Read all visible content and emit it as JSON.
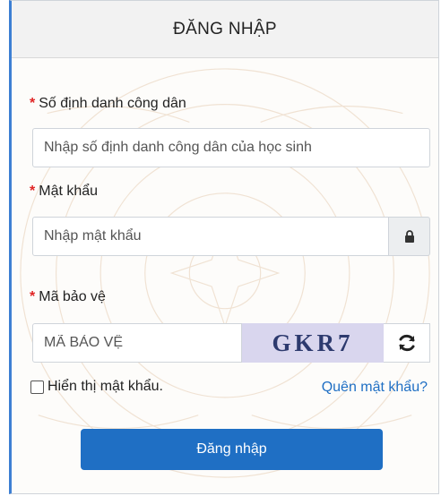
{
  "header": {
    "title": "ĐĂNG NHẬP"
  },
  "form": {
    "required_mark": "*",
    "id_field": {
      "label": "Số định danh công dân",
      "placeholder": "Nhập số định danh công dân của học sinh"
    },
    "password_field": {
      "label": "Mật khẩu",
      "placeholder": "Nhập mật khẩu"
    },
    "captcha_field": {
      "label": "Mã bảo vệ",
      "placeholder": "MÃ BẢO VỆ",
      "captcha_text": "GKR7"
    },
    "show_password": {
      "label": "Hiển thị mật khẩu.",
      "checked": false
    },
    "forgot_link": "Quên mật khẩu?",
    "submit_label": "Đăng nhập"
  },
  "icons": {
    "lock": "lock-icon",
    "refresh": "refresh-icon"
  },
  "colors": {
    "accent": "#1f6fc4",
    "required": "#e02424",
    "captcha_bg": "#d9d6ee"
  }
}
